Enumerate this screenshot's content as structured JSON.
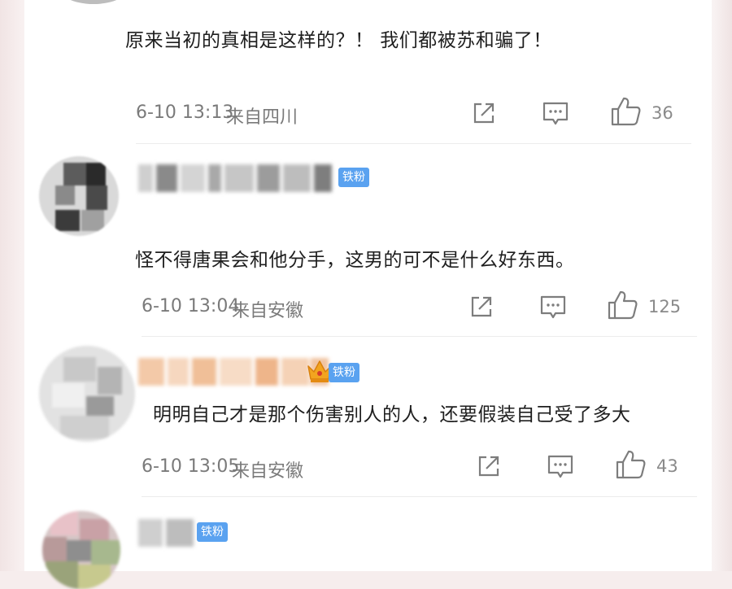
{
  "comments": [
    {
      "text": "原来当初的真相是这样的？！ 我们都被苏和骗了！",
      "date": "6-10 13:13",
      "location": "来自四川",
      "likes": "36"
    },
    {
      "badge": "铁粉",
      "text": "怪不得唐果会和他分手，这男的可不是什么好东西。",
      "date": "6-10 13:04",
      "location": "来自安徽",
      "likes": "125"
    },
    {
      "badge": "铁粉",
      "text": "明明自己才是那个伤害别人的人，还要假装自己受了多大",
      "date": "6-10 13:05",
      "location": "来自安徽",
      "likes": "43"
    },
    {
      "badge": "铁粉"
    }
  ],
  "icons": [
    "share-icon",
    "comment-icon",
    "like-icon",
    "crown-icon"
  ],
  "colors": {
    "badge": "#5aa2f0",
    "text": "#1e1e1e",
    "meta": "#7a7a7a",
    "crown": "#f0a020"
  }
}
